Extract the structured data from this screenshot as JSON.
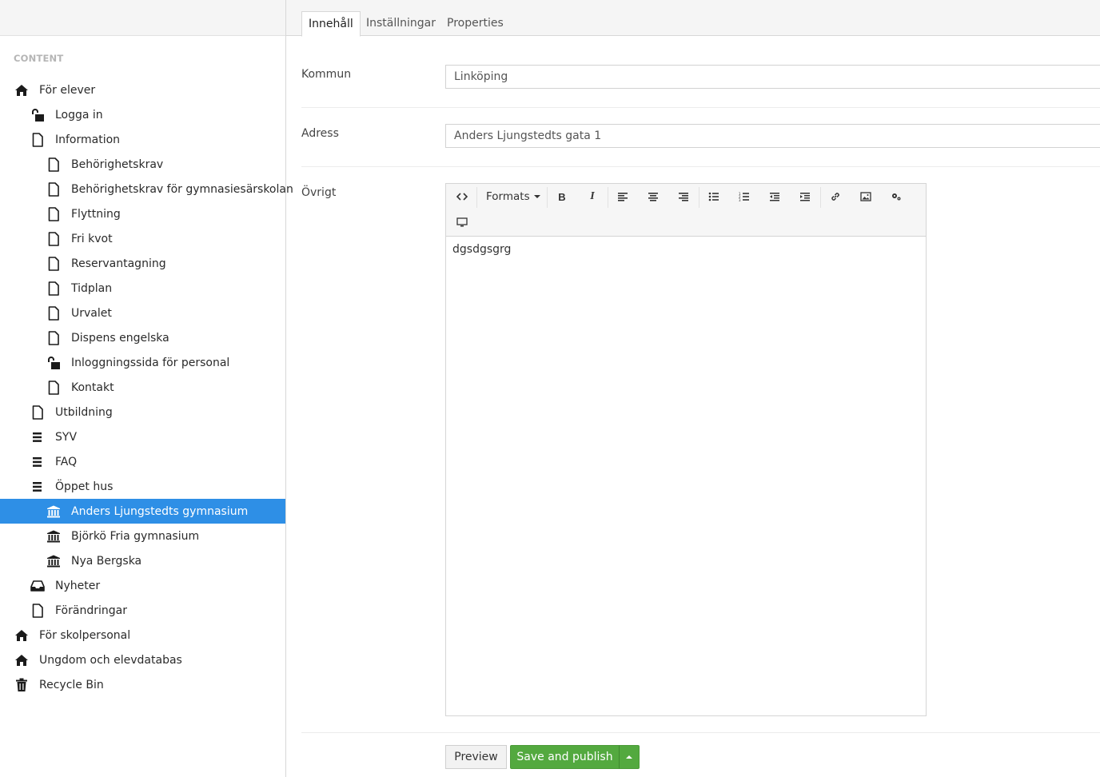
{
  "sidebar": {
    "section_title": "CONTENT",
    "tree": [
      {
        "label": "För elever",
        "icon": "home-icon",
        "level": 0
      },
      {
        "label": "Logga in",
        "icon": "unlock-icon",
        "level": 1
      },
      {
        "label": "Information",
        "icon": "document-icon",
        "level": 1
      },
      {
        "label": "Behörighetskrav",
        "icon": "document-icon",
        "level": 2
      },
      {
        "label": "Behörighetskrav för gymnasiesärskolan",
        "icon": "document-icon",
        "level": 2
      },
      {
        "label": "Flyttning",
        "icon": "document-icon",
        "level": 2
      },
      {
        "label": "Fri kvot",
        "icon": "document-icon",
        "level": 2
      },
      {
        "label": "Reservantagning",
        "icon": "document-icon",
        "level": 2
      },
      {
        "label": "Tidplan",
        "icon": "document-icon",
        "level": 2
      },
      {
        "label": "Urvalet",
        "icon": "document-icon",
        "level": 2
      },
      {
        "label": "Dispens engelska",
        "icon": "document-icon",
        "level": 2
      },
      {
        "label": "Inloggningssida för personal",
        "icon": "unlock-icon",
        "level": 2
      },
      {
        "label": "Kontakt",
        "icon": "document-icon",
        "level": 2
      },
      {
        "label": "Utbildning",
        "icon": "document-icon",
        "level": 1
      },
      {
        "label": "SYV",
        "icon": "list-icon",
        "level": 1
      },
      {
        "label": "FAQ",
        "icon": "list-icon",
        "level": 1
      },
      {
        "label": "Öppet hus",
        "icon": "list-icon",
        "level": 1
      },
      {
        "label": "Anders Ljungstedts gymnasium",
        "icon": "institution-icon",
        "level": 2,
        "selected": true
      },
      {
        "label": "Björkö Fria gymnasium",
        "icon": "institution-icon",
        "level": 2
      },
      {
        "label": "Nya Bergska",
        "icon": "institution-icon",
        "level": 2
      },
      {
        "label": "Nyheter",
        "icon": "inbox-icon",
        "level": 1
      },
      {
        "label": "Förändringar",
        "icon": "document-icon",
        "level": 1
      },
      {
        "label": "För skolpersonal",
        "icon": "home-icon",
        "level": 0
      },
      {
        "label": "Ungdom och elevdatabas",
        "icon": "home-icon",
        "level": 0
      },
      {
        "label": "Recycle Bin",
        "icon": "trash-icon",
        "level": 0
      }
    ],
    "selected_color": "#2e8fe6"
  },
  "tabs": [
    "Innehåll",
    "Inställningar",
    "Properties"
  ],
  "form": {
    "kommun": {
      "label": "Kommun",
      "value": "Linköping"
    },
    "adress": {
      "label": "Adress",
      "value": "Anders Ljungstedts gata 1"
    },
    "ovrigt": {
      "label": "Övrigt"
    }
  },
  "editor": {
    "formats_label": "Formats",
    "content": "dgsdgsgrg",
    "toolbar_icons": [
      "code-icon",
      "bold-icon",
      "italic-icon",
      "align-left-icon",
      "align-center-icon",
      "align-right-icon",
      "bullet-list-icon",
      "numbered-list-icon",
      "outdent-icon",
      "indent-icon",
      "link-icon",
      "image-icon",
      "macro-icon",
      "embed-icon"
    ]
  },
  "actions": {
    "preview_label": "Preview",
    "publish_label": "Save and publish",
    "publish_color": "#53a93f"
  }
}
